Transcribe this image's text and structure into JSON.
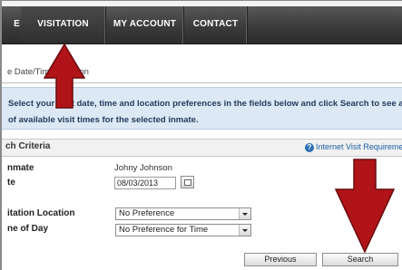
{
  "nav": {
    "items": [
      {
        "label": "E"
      },
      {
        "label": "VISITATION"
      },
      {
        "label": "MY ACCOUNT"
      },
      {
        "label": "CONTACT"
      }
    ]
  },
  "breadcrumb": "e Date/Time Location",
  "info": {
    "line1": "Select your visit date, time and location preferences in the fields below and click Search to see a list",
    "line2": "of available visit times for the selected inmate."
  },
  "section": {
    "title": "ch Criteria",
    "link": "Internet Visit Requirements"
  },
  "form": {
    "inmate_label": "nmate",
    "inmate_value": "Johny Johnson",
    "date_label": "te",
    "date_value": "08/03/2013",
    "location_label": "itation Location",
    "location_value": "No Preference",
    "time_label": "ne of Day",
    "time_value": "No Preference for Time"
  },
  "buttons": {
    "previous": "Previous",
    "search": "Search"
  },
  "colors": {
    "arrow": "#b01418",
    "info_bg": "#dde8f5",
    "nav_bg": "#3b3b3b"
  }
}
